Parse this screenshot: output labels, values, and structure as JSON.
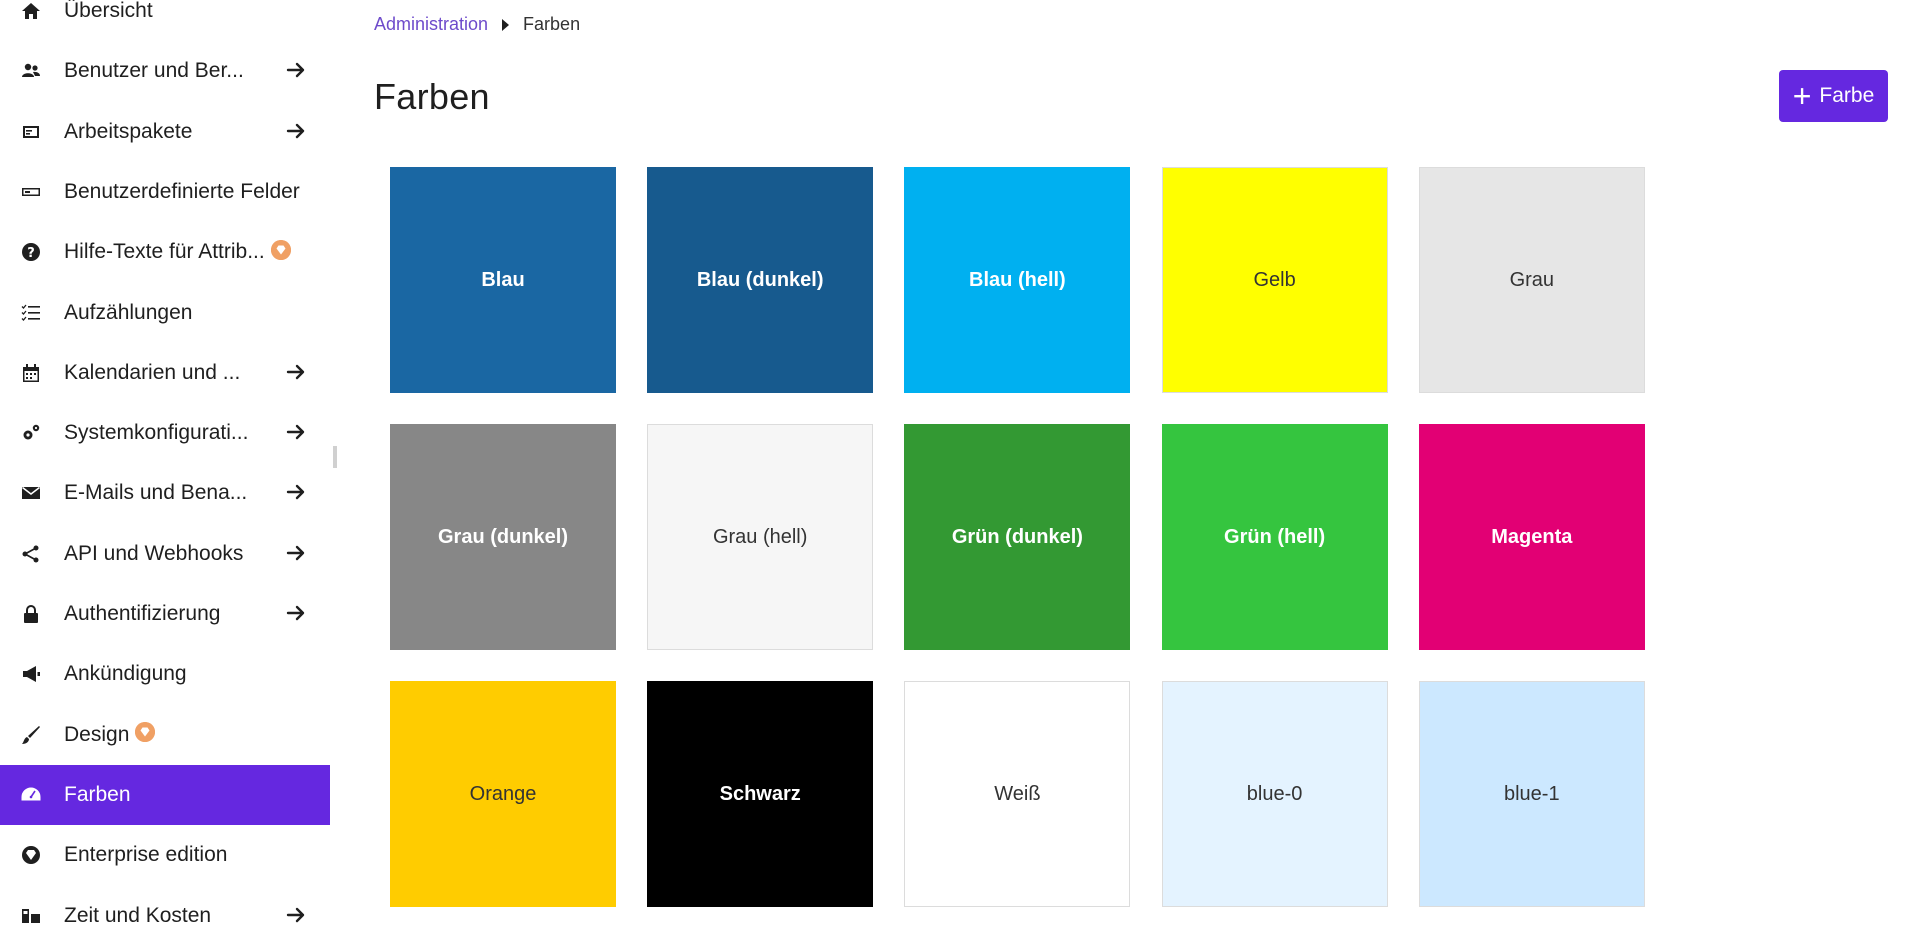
{
  "sidebar": {
    "items": [
      {
        "label": "Übersicht",
        "icon": "home-icon",
        "arrow": false,
        "badge": false,
        "active": false
      },
      {
        "label": "Benutzer und Ber...",
        "icon": "users-icon",
        "arrow": true,
        "badge": false,
        "active": false
      },
      {
        "label": "Arbeitspakete",
        "icon": "work-packages-icon",
        "arrow": true,
        "badge": false,
        "active": false
      },
      {
        "label": "Benutzerdefinierte Felder",
        "icon": "custom-fields-icon",
        "arrow": false,
        "badge": false,
        "active": false
      },
      {
        "label": "Hilfe-Texte für Attrib...",
        "icon": "help-icon",
        "arrow": false,
        "badge": true,
        "active": false
      },
      {
        "label": "Aufzählungen",
        "icon": "enumerations-icon",
        "arrow": false,
        "badge": false,
        "active": false
      },
      {
        "label": "Kalendarien und ...",
        "icon": "calendar-icon",
        "arrow": true,
        "badge": false,
        "active": false
      },
      {
        "label": "Systemkonfigurati...",
        "icon": "settings-icon",
        "arrow": true,
        "badge": false,
        "active": false
      },
      {
        "label": "E-Mails und Bena...",
        "icon": "mail-icon",
        "arrow": true,
        "badge": false,
        "active": false
      },
      {
        "label": "API und Webhooks",
        "icon": "api-icon",
        "arrow": true,
        "badge": false,
        "active": false
      },
      {
        "label": "Authentifizierung",
        "icon": "lock-icon",
        "arrow": true,
        "badge": false,
        "active": false
      },
      {
        "label": "Ankündigung",
        "icon": "megaphone-icon",
        "arrow": false,
        "badge": false,
        "active": false
      },
      {
        "label": "Design",
        "icon": "brush-icon",
        "arrow": false,
        "badge": true,
        "active": false
      },
      {
        "label": "Farben",
        "icon": "dashboard-icon",
        "arrow": false,
        "badge": false,
        "active": true
      },
      {
        "label": "Enterprise edition",
        "icon": "enterprise-icon",
        "arrow": false,
        "badge": false,
        "active": false
      },
      {
        "label": "Zeit und Kosten",
        "icon": "time-cost-icon",
        "arrow": true,
        "badge": false,
        "active": false
      }
    ]
  },
  "breadcrumb": {
    "parent": "Administration",
    "current": "Farben"
  },
  "page": {
    "title": "Farben",
    "add_button_label": "Farbe"
  },
  "colors": [
    {
      "name": "Blau",
      "hex": "#1a67a3",
      "text": "#ffffff"
    },
    {
      "name": "Blau (dunkel)",
      "hex": "#175a8e",
      "text": "#ffffff"
    },
    {
      "name": "Blau (hell)",
      "hex": "#00b0f0",
      "text": "#ffffff"
    },
    {
      "name": "Gelb",
      "hex": "#ffff00",
      "text": "#333333"
    },
    {
      "name": "Grau",
      "hex": "#e6e6e6",
      "text": "#333333"
    },
    {
      "name": "Grau (dunkel)",
      "hex": "#878787",
      "text": "#ffffff"
    },
    {
      "name": "Grau (hell)",
      "hex": "#f6f6f6",
      "text": "#333333"
    },
    {
      "name": "Grün (dunkel)",
      "hex": "#339933",
      "text": "#ffffff"
    },
    {
      "name": "Grün (hell)",
      "hex": "#35c53f",
      "text": "#ffffff"
    },
    {
      "name": "Magenta",
      "hex": "#e20074",
      "text": "#ffffff"
    },
    {
      "name": "Orange",
      "hex": "#ffcc00",
      "text": "#333333"
    },
    {
      "name": "Schwarz",
      "hex": "#000000",
      "text": "#ffffff"
    },
    {
      "name": "Weiß",
      "hex": "#ffffff",
      "text": "#333333"
    },
    {
      "name": "blue-0",
      "hex": "#e4f3ff",
      "text": "#333333"
    },
    {
      "name": "blue-1",
      "hex": "#cce8ff",
      "text": "#333333"
    }
  ],
  "theme": {
    "accent": "#6528e0",
    "link": "#6e4bcb",
    "badge": "#f0a064"
  }
}
